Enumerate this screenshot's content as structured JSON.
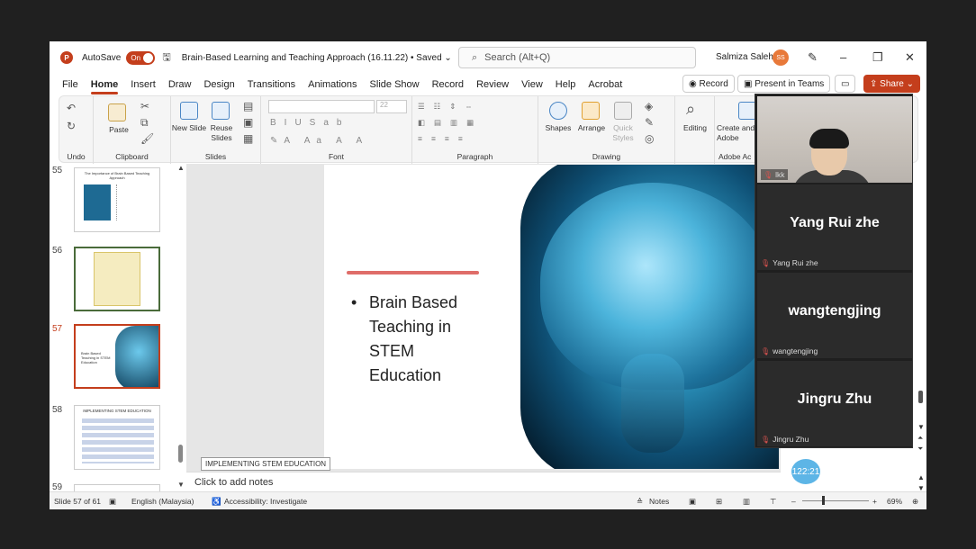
{
  "app": {
    "autosave_label": "AutoSave",
    "autosave_state": "On",
    "doc_title": "Brain-Based Learning and Teaching Approach (16.11.22) • Saved ⌄",
    "search_placeholder": "Search (Alt+Q)",
    "user_name": "Salmiza Saleh",
    "user_initials": "SS"
  },
  "menu": {
    "tabs": [
      "File",
      "Home",
      "Insert",
      "Draw",
      "Design",
      "Transitions",
      "Animations",
      "Slide Show",
      "Record",
      "Review",
      "View",
      "Help",
      "Acrobat"
    ],
    "active": "Home",
    "record_label": "Record",
    "present_label": "Present in Teams",
    "share_label": "Share"
  },
  "ribbon": {
    "undo": "Undo",
    "clipboard": "Clipboard",
    "paste": "Paste",
    "new_slide": "New Slide",
    "reuse_slides": "Reuse Slides",
    "slides": "Slides",
    "font_size": "22",
    "font": "Font",
    "paragraph": "Paragraph",
    "shapes": "Shapes",
    "arrange": "Arrange",
    "quick_styles": "Quick Styles",
    "drawing": "Drawing",
    "editing": "Editing",
    "create_adobe": "Create and Adobe",
    "adobe": "Adobe Ac"
  },
  "thumbnails": [
    {
      "num": "55",
      "title": "The Importance of Brain Based Teaching Approach"
    },
    {
      "num": "56",
      "title": ""
    },
    {
      "num": "57",
      "title": "Brain Based Teaching in STEM Education"
    },
    {
      "num": "58",
      "title": "IMPLEMENTING STEM EDUCATION"
    },
    {
      "num": "59",
      "title": ""
    }
  ],
  "slide": {
    "bullet": "Brain Based Teaching in STEM Education",
    "tooltip": "IMPLEMENTING STEM EDUCATION",
    "notes_placeholder": "Click to add notes"
  },
  "status": {
    "slide_info": "Slide 57 of 61",
    "language": "English (Malaysia)",
    "accessibility": "Accessibility: Investigate",
    "notes": "Notes",
    "zoom": "69%"
  },
  "teams": {
    "participants": [
      {
        "name": "lkk",
        "display": ""
      },
      {
        "name": "Yang Rui zhe",
        "display": "Yang Rui zhe"
      },
      {
        "name": "wangtengjing",
        "display": "wangtengjing"
      },
      {
        "name": "Jingru Zhu",
        "display": "Jingru Zhu"
      }
    ],
    "timer": "122:21"
  },
  "colors": {
    "accent": "#c43e1c",
    "teams_bg": "#1f1f1f"
  }
}
